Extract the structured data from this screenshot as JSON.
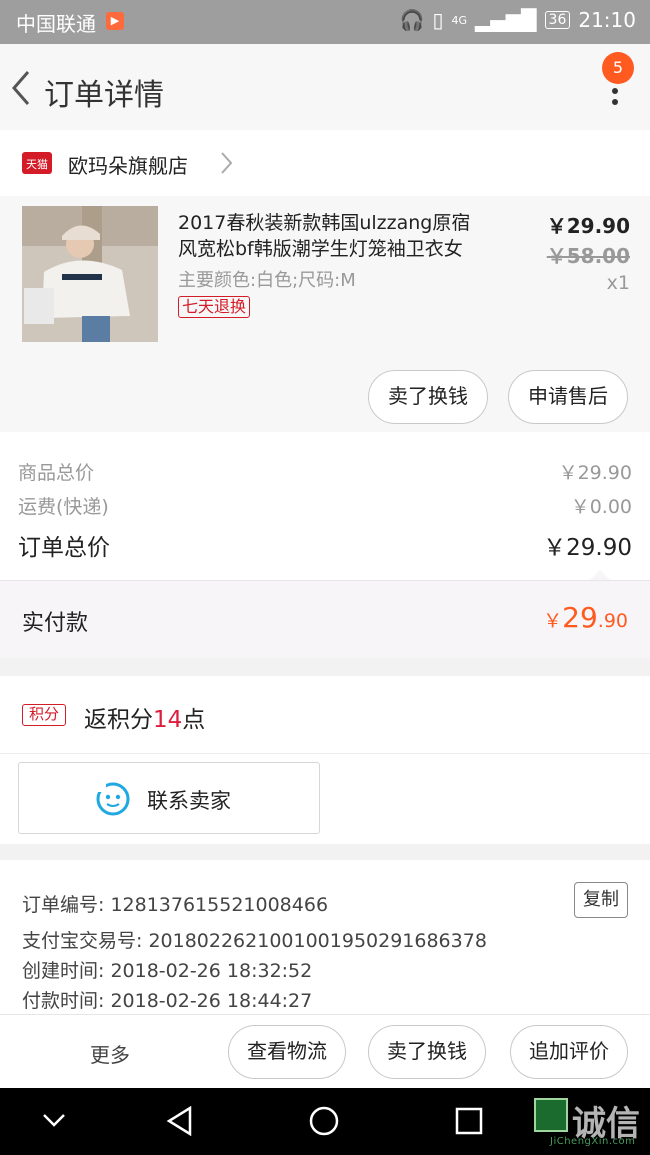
{
  "status_bar": {
    "carrier": "中国联通",
    "network": "4G",
    "battery": "36",
    "time": "21:10"
  },
  "nav": {
    "title": "订单详情",
    "badge_count": "5"
  },
  "shop": {
    "badge": "天猫",
    "name": "欧玛朵旗舰店"
  },
  "item": {
    "title_line1": "2017春秋装新款韩国ulzzang原宿",
    "title_line2": "风宽松bf韩版潮学生灯笼袖卫衣女",
    "spec": "主要颜色:白色;尺码:M",
    "tag": "七天退换",
    "price": "￥29.90",
    "original_price": "￥58.00",
    "quantity": "x1",
    "btn_sell": "卖了换钱",
    "btn_after_sale": "申请售后"
  },
  "summary": {
    "goods_total_label": "商品总价",
    "goods_total": "￥29.90",
    "shipping_label": "运费(快递)",
    "shipping": "￥0.00",
    "order_total_label": "订单总价",
    "order_total": "￥29.90"
  },
  "paid": {
    "label": "实付款",
    "currency": "￥",
    "integer": "29",
    "decimal": ".90"
  },
  "points": {
    "icon_text": "积分",
    "prefix": "返积分",
    "value": "14",
    "suffix": "点"
  },
  "contact": {
    "label": "联系卖家"
  },
  "order_info": {
    "order_no": "订单编号: 128137615521008466",
    "alipay_no": "支付宝交易号: 2018022621001001950291686378",
    "created": "创建时间: 2018-02-26 18:32:52",
    "paid_time": "付款时间: 2018-02-26 18:44:27",
    "copy_label": "复制"
  },
  "bottom_bar": {
    "more": "更多",
    "logistics": "查看物流",
    "sell": "卖了换钱",
    "review": "追加评价"
  },
  "watermark": {
    "text": "诚信",
    "sub": "JiChengXin.com"
  },
  "colors": {
    "accent": "#ff5a1f",
    "tmall_red": "#d41c29",
    "points_red": "#e01c3c"
  }
}
